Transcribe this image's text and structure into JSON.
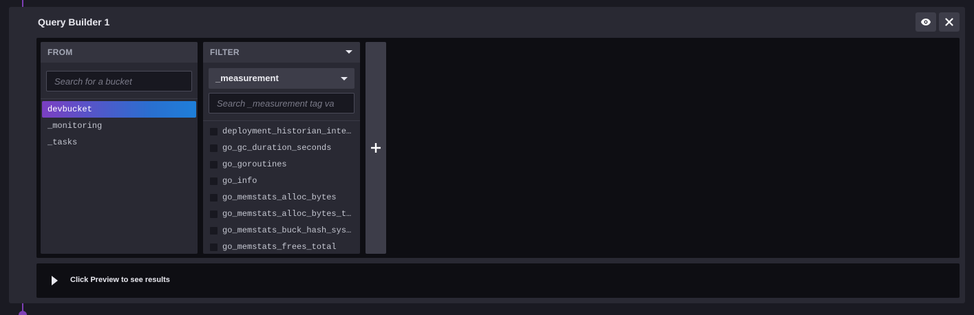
{
  "panel": {
    "title": "Query Builder 1",
    "eye_icon": "eye-icon",
    "close_icon": "close-icon"
  },
  "from": {
    "header": "FROM",
    "search_placeholder": "Search for a bucket",
    "buckets": [
      {
        "label": "devbucket",
        "selected": true
      },
      {
        "label": "_monitoring",
        "selected": false
      },
      {
        "label": "_tasks",
        "selected": false
      }
    ]
  },
  "filter": {
    "header": "FILTER",
    "selected_key": "_measurement",
    "search_placeholder": "Search _measurement tag va",
    "tags": [
      "deployment_historian_internal",
      "go_gc_duration_seconds",
      "go_goroutines",
      "go_info",
      "go_memstats_alloc_bytes",
      "go_memstats_alloc_bytes_total",
      "go_memstats_buck_hash_sys_bytes",
      "go_memstats_frees_total"
    ]
  },
  "add_card": {
    "icon": "plus-icon"
  },
  "preview": {
    "text": "Click Preview to see results",
    "icon": "play-icon"
  },
  "colors": {
    "accent_purple": "#7d3fb5",
    "selected_gradient_start": "#7b3fc2",
    "selected_gradient_end": "#1e7fd9",
    "panel_bg": "#292933",
    "builder_bg": "#0e0e13"
  }
}
